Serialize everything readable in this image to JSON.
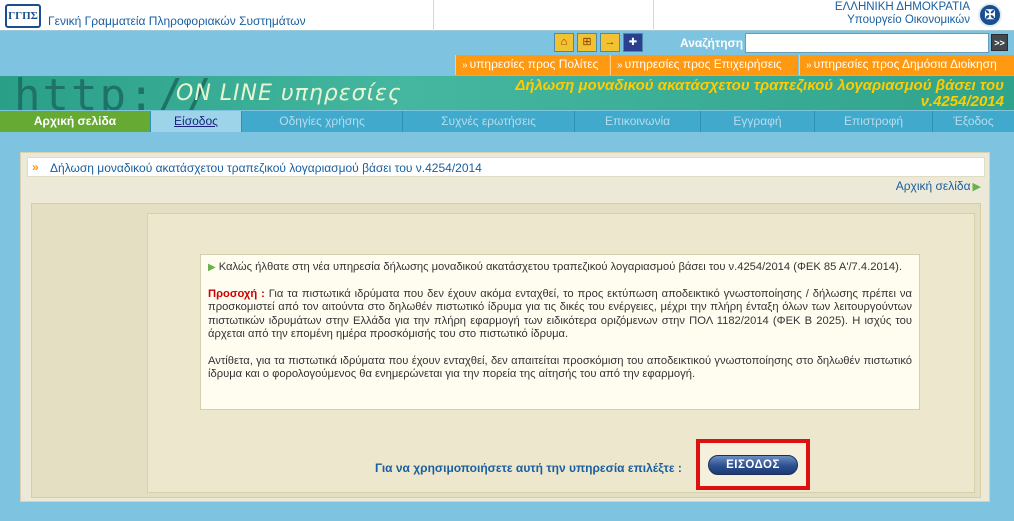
{
  "header": {
    "logo_text": "ΓΓΠΣ",
    "org_name": "Γενική Γραμματεία Πληροφοριακών Συστημάτων",
    "gov_line1": "ΕΛΛΗΝΙΚΗ ΔΗΜΟΚΡΑΤΙΑ",
    "gov_line2": "Υπουργείο Οικονομικών"
  },
  "toolbar": {
    "icons": [
      "home-icon",
      "sitemap-icon",
      "links-icon",
      "english-flag-icon"
    ],
    "search_label": "Αναζήτηση",
    "search_value": "",
    "search_go": ">>"
  },
  "services": [
    {
      "label": "υπηρεσίες προς Πολίτες"
    },
    {
      "label": "υπηρεσίες προς Επιχειρήσεις"
    },
    {
      "label": "υπηρεσίες προς Δημόσια Διοίκηση"
    }
  ],
  "banner": {
    "http_text": "http://",
    "online_text": "ON LINE υπηρεσίες",
    "title_line1": "Δήλωση μοναδικού ακατάσχετου τραπεζικού λογαριασμού βάσει του",
    "title_line2": "ν.4254/2014"
  },
  "nav": [
    {
      "label": "Αρχική σελίδα"
    },
    {
      "label": "Είσοδος"
    },
    {
      "label": "Οδηγίες χρήσης"
    },
    {
      "label": "Συχνές ερωτήσεις"
    },
    {
      "label": "Επικοινωνία"
    },
    {
      "label": "Εγγραφή"
    },
    {
      "label": "Επιστροφή"
    },
    {
      "label": "Έξοδος"
    }
  ],
  "main": {
    "breadcrumb": "Δήλωση μοναδικού ακατάσχετου τραπεζικού λογαριασμού βάσει του ν.4254/2014",
    "home_link": "Αρχική σελίδα",
    "welcome": "Καλώς ήλθατε στη νέα υπηρεσία δήλωσης μοναδικού ακατάσχετου τραπεζικού λογαριασμού βάσει του ν.4254/2014 (ΦΕΚ 85 Α'/7.4.2014).",
    "warning_label": "Προσοχή :",
    "warning_text": "Για τα πιστωτικά ιδρύματα που δεν έχουν ακόμα ενταχθεί, το προς εκτύπωση αποδεικτικό γνωστοποίησης / δήλωσης πρέπει να προσκομιστεί από τον αιτούντα στο δηλωθέν πιστωτικό ίδρυμα για τις δικές του ενέργειες, μέχρι την πλήρη ένταξη όλων των λειτουργούντων πιστωτικών ιδρυμάτων στην Ελλάδα για την πλήρη εφαρμογή των ειδικότερα οριζόμενων στην ΠΟΛ 1182/2014 (ΦΕΚ Β 2025). Η ισχύς του άρχεται από την επομένη ημέρα προσκόμισής του στο πιστωτικό ίδρυμα.",
    "info_text": "Αντίθετα, για τα πιστωτικά ιδρύματα που έχουν ενταχθεί, δεν απαιτείται προσκόμιση του αποδεικτικού γνωστοποίησης στο δηλωθέν πιστωτικό ίδρυμα και ο φορολογούμενος θα ενημερώνεται για την πορεία της αίτησής του από την εφαρμογή.",
    "choose_label": "Για να χρησιμοποιήσετε αυτή την υπηρεσία επιλέξτε :",
    "login_button": "ΕΙΣΟΔΟΣ"
  },
  "colors": {
    "accent_blue": "#41a9cc",
    "service_orange": "#ff9911",
    "active_green": "#66aa33",
    "highlight_red": "#dd1111"
  }
}
